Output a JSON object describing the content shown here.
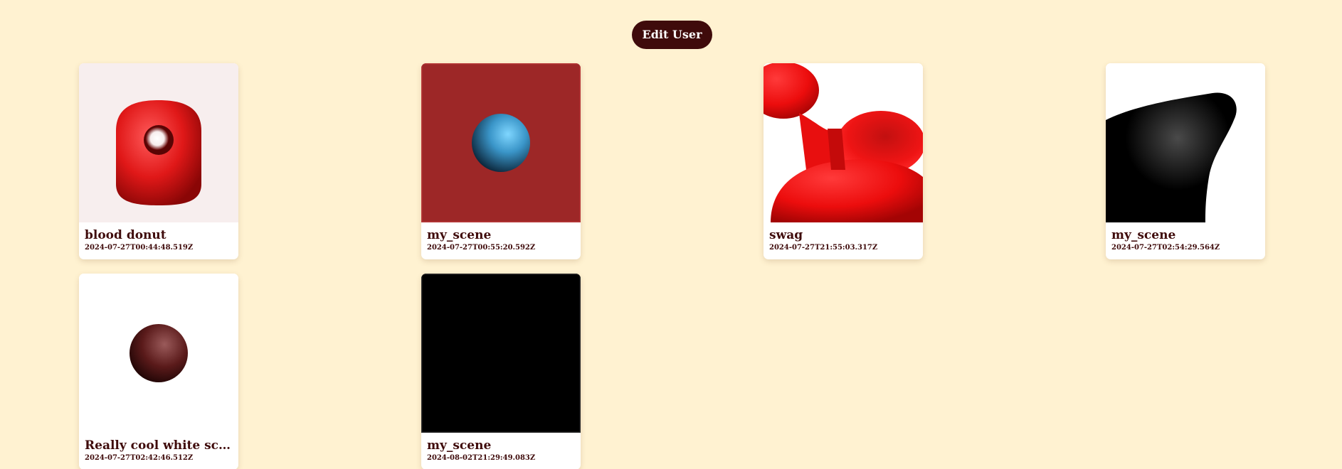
{
  "header": {
    "edit_user_label": "Edit User"
  },
  "colors": {
    "background": "#fff2d1",
    "accent": "#3f0b0b",
    "card": "#ffffff"
  },
  "scenes": [
    {
      "title": "blood donut",
      "date": "2024-07-27T00:44:48.519Z",
      "preview": "red-donut"
    },
    {
      "title": "my_scene",
      "date": "2024-07-27T00:55:20.592Z",
      "preview": "blue-sphere-on-red"
    },
    {
      "title": "swag",
      "date": "2024-07-27T21:55:03.317Z",
      "preview": "red-blobs"
    },
    {
      "title": "my_scene",
      "date": "2024-07-27T02:54:29.564Z",
      "preview": "black-blob"
    },
    {
      "title": "Really cool white sce...",
      "date": "2024-07-27T02:42:46.512Z",
      "preview": "dark-red-sphere"
    },
    {
      "title": "my_scene",
      "date": "2024-08-02T21:29:49.083Z",
      "preview": "black-square"
    }
  ]
}
